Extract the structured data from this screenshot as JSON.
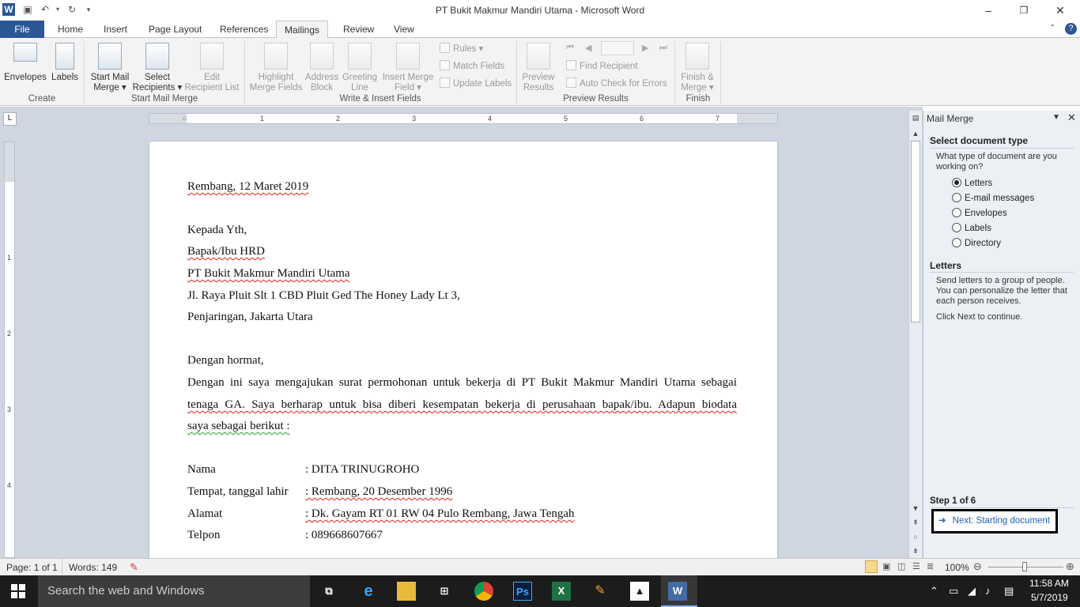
{
  "window": {
    "title": "PT Bukit Makmur Mandiri Utama  -  Microsoft Word",
    "app_icon": "W",
    "minimize": "–",
    "restore": "❐",
    "close": "✕"
  },
  "tabs": [
    "File",
    "Home",
    "Insert",
    "Page Layout",
    "References",
    "Mailings",
    "Review",
    "View"
  ],
  "active_tab": "Mailings",
  "ribbon": {
    "groups": [
      "Create",
      "Start Mail Merge",
      "Write & Insert Fields",
      "Preview Results",
      "Finish"
    ],
    "envelopes": "Envelopes",
    "labels": "Labels",
    "start_mail_merge": [
      "Start Mail",
      "Merge ▾"
    ],
    "select_recipients": [
      "Select",
      "Recipients ▾"
    ],
    "edit_recipient_list": [
      "Edit",
      "Recipient List"
    ],
    "highlight_merge_fields": [
      "Highlight",
      "Merge Fields"
    ],
    "address_block": [
      "Address",
      "Block"
    ],
    "greeting_line": [
      "Greeting",
      "Line"
    ],
    "insert_merge_field": [
      "Insert Merge",
      "Field ▾"
    ],
    "rules": "Rules ▾",
    "match_fields": "Match Fields",
    "update_labels": "Update Labels",
    "preview_results": [
      "Preview",
      "Results"
    ],
    "find_recipient": "Find Recipient",
    "auto_check": "Auto Check for Errors",
    "finish_merge": [
      "Finish &",
      "Merge ▾"
    ]
  },
  "ruler_numbers": [
    "1",
    "2",
    "3",
    "4",
    "5",
    "6",
    "7"
  ],
  "vruler_numbers": [
    "1",
    "2",
    "3",
    "4"
  ],
  "document": {
    "date": "Rembang, 12 Maret 2019",
    "to": "Kepada Yth,",
    "hrd": "Bapak/Ibu HRD",
    "company": "PT Bukit Makmur Mandiri Utama",
    "address1": "Jl. Raya Pluit Slt 1 CBD Pluit Ged The Honey Lady Lt 3,",
    "address2": "Penjaringan, Jakarta Utara",
    "greeting": "Dengan hormat,",
    "para_line1": "Dengan ini saya mengajukan surat permohonan untuk bekerja di PT Bukit Makmur Mandiri Utama sebagai",
    "para_line2": "tenaga GA. Saya berharap untuk bisa diberi kesempatan bekerja di perusahaan bapak/ibu. Adapun biodata",
    "para_line3": "saya sebagai berikut :",
    "fields": [
      {
        "label": "Nama",
        "value": ": DITA TRINUGROHO"
      },
      {
        "label": "Tempat, tanggal lahir",
        "value": ": Rembang, 20 Desember 1996"
      },
      {
        "label": "Alamat",
        "value": ": Dk. Gayam RT 01 RW 04 Pulo Rembang, Jawa Tengah"
      },
      {
        "label": "Telpon",
        "value": ": 089668607667"
      }
    ]
  },
  "pane": {
    "title": "Mail Merge",
    "section1": "Select document type",
    "question": "What type of document are you working on?",
    "options": [
      "Letters",
      "E-mail messages",
      "Envelopes",
      "Labels",
      "Directory"
    ],
    "selected": "Letters",
    "section2": "Letters",
    "desc": "Send letters to a group of people. You can personalize the letter that each person receives.",
    "click_next": "Click Next to continue.",
    "step": "Step 1 of 6",
    "next": "Next: Starting document"
  },
  "status": {
    "page": "Page: 1 of 1",
    "words": "Words: 149",
    "zoom": "100%"
  },
  "taskbar": {
    "search_placeholder": "Search the web and Windows",
    "time": "11:58 AM",
    "date": "5/7/2019"
  },
  "colors": {
    "file_tab": "#2b5797",
    "workspace": "#cfd6e1",
    "pane": "#eceff4",
    "taskbar": "#1c1c1c"
  }
}
